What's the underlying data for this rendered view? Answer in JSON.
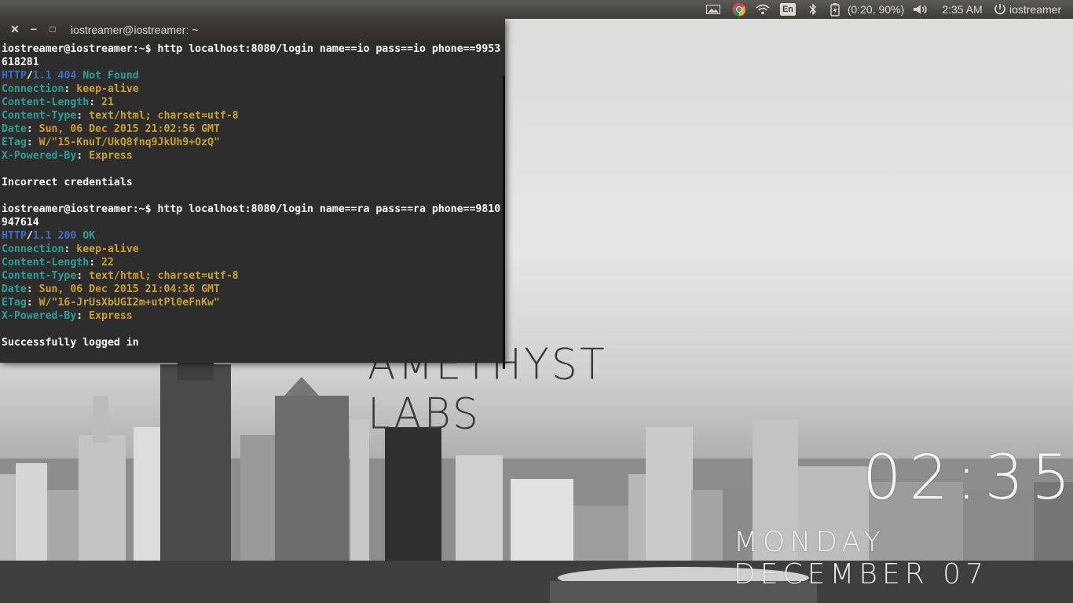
{
  "top_panel": {
    "indicators": [
      {
        "name": "screen-icon"
      },
      {
        "name": "chrome-icon"
      },
      {
        "name": "wifi-icon"
      },
      {
        "name": "keyboard-layout",
        "label": "En"
      },
      {
        "name": "bluetooth-icon"
      },
      {
        "name": "battery-icon",
        "label": "(0:20, 90%)"
      },
      {
        "name": "volume-icon"
      }
    ],
    "time": "2:35 AM",
    "user": "iostreamer"
  },
  "terminal": {
    "title": "iostreamer@iostreamer: ~",
    "buttons": {
      "close": "✕",
      "minimize": "−",
      "maximize": "□"
    },
    "blocks": [
      {
        "command_line": "iostreamer@iostreamer:~$ http localhost:8080/login name==io pass==io phone==9953",
        "command_wrap": "618281",
        "status": {
          "proto": "HTTP",
          "version": "1.1",
          "code": "404",
          "text": "Not Found"
        },
        "headers": [
          {
            "key": "Connection",
            "value": "keep-alive"
          },
          {
            "key": "Content-Length",
            "value": "21"
          },
          {
            "key": "Content-Type",
            "value": "text/html; charset=utf-8"
          },
          {
            "key": "Date",
            "value": "Sun, 06 Dec 2015 21:02:56 GMT"
          },
          {
            "key": "ETag",
            "value": "W/\"15-KnuT/UkQ8fnq9JkUh9+OzQ\""
          },
          {
            "key": "X-Powered-By",
            "value": "Express"
          }
        ],
        "body": "Incorrect credentials"
      },
      {
        "command_line": "iostreamer@iostreamer:~$ http localhost:8080/login name==ra pass==ra phone==9810",
        "command_wrap": "947614",
        "status": {
          "proto": "HTTP",
          "version": "1.1",
          "code": "200",
          "text": "OK"
        },
        "headers": [
          {
            "key": "Connection",
            "value": "keep-alive"
          },
          {
            "key": "Content-Length",
            "value": "22"
          },
          {
            "key": "Content-Type",
            "value": "text/html; charset=utf-8"
          },
          {
            "key": "Date",
            "value": "Sun, 06 Dec 2015 21:04:36 GMT"
          },
          {
            "key": "ETag",
            "value": "W/\"16-JrUsXbUGI2m+utPl0eFnKw\""
          },
          {
            "key": "X-Powered-By",
            "value": "Express"
          }
        ],
        "body": "Successfully logged in"
      }
    ]
  },
  "wallpaper": {
    "brand": "AMETHYST LABS",
    "clock_time": "02:35",
    "clock_date": "MONDAY DECEMBER 07"
  },
  "colors": {
    "terminal_bg": "#2d2d2d",
    "http_blue": "#3b6fc4",
    "header_key": "#2aa198",
    "header_value": "#c9a227",
    "panel_bg": "#3c3c3a"
  }
}
